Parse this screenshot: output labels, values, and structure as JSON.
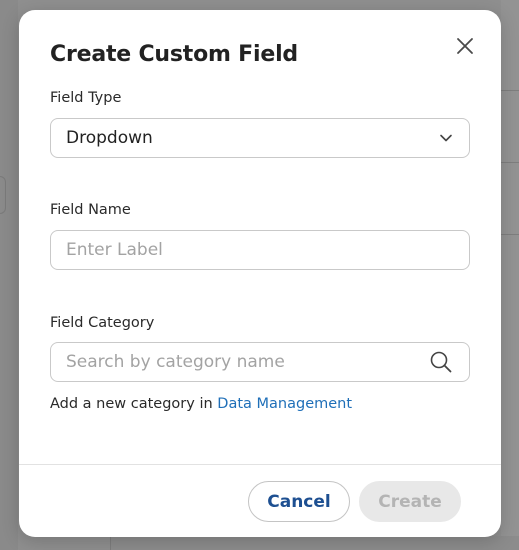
{
  "dialog": {
    "title": "Create Custom Field",
    "close_icon": "close-icon"
  },
  "field_type": {
    "label": "Field Type",
    "value": "Dropdown",
    "icon": "chevron-down-icon"
  },
  "field_name": {
    "label": "Field Name",
    "value": "",
    "placeholder": "Enter Label"
  },
  "field_category": {
    "label": "Field Category",
    "value": "",
    "placeholder": "Search by category name",
    "icon": "search-icon"
  },
  "helper": {
    "text": "Add a new category in ",
    "link": "Data Management"
  },
  "footer": {
    "cancel_label": "Cancel",
    "create_label": "Create",
    "create_disabled": true
  },
  "colors": {
    "link": "#1f6fb8",
    "cancel_text": "#1d4f91",
    "disabled_bg": "#e8e8e8",
    "disabled_text": "#b4b4b4",
    "overlay": "#8f8f8f"
  }
}
